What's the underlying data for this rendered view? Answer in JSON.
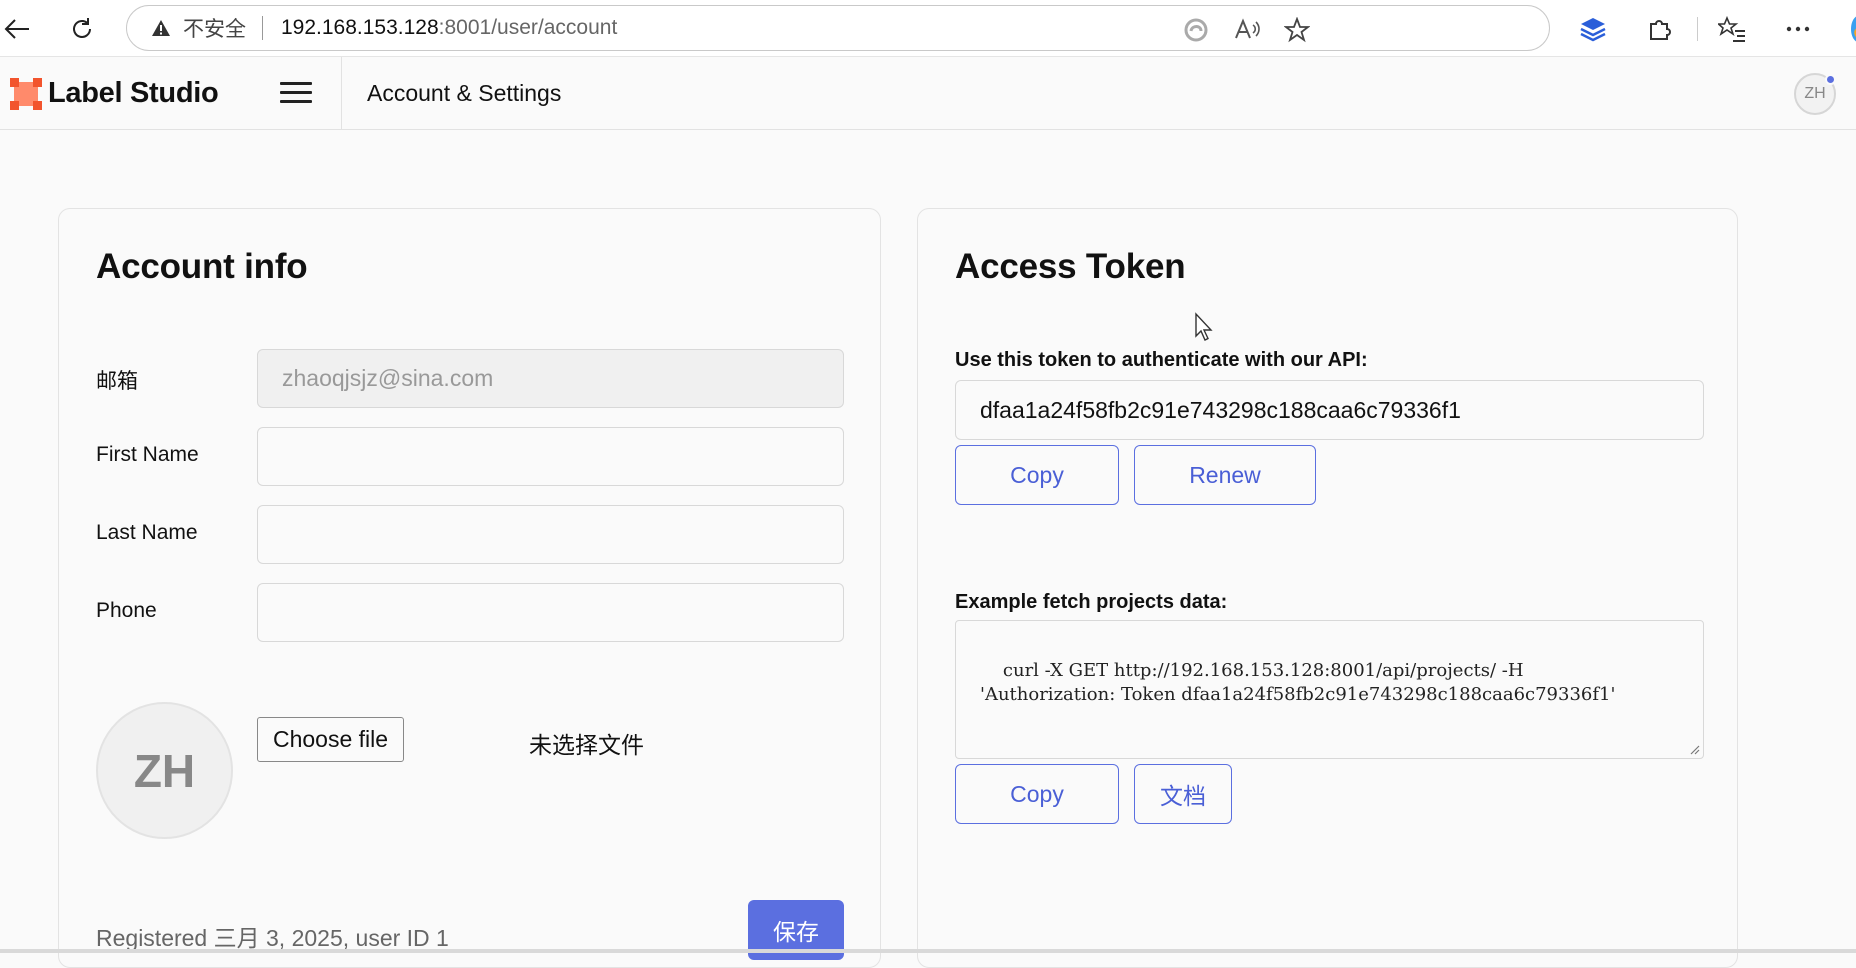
{
  "browser": {
    "insecure_label": "不安全",
    "url_host": "192.168.153.128",
    "url_path": ":8001/user/account"
  },
  "app": {
    "logo_text": "Label Studio",
    "page_title": "Account & Settings",
    "user_initials": "ZH",
    "accent_color": "#5b6fe0",
    "logo_color": "#ff6f4e"
  },
  "account": {
    "title": "Account info",
    "email_label": "邮箱",
    "email_value": "zhaoqjsjz@sina.com",
    "first_name_label": "First Name",
    "first_name_value": "",
    "last_name_label": "Last Name",
    "last_name_value": "",
    "phone_label": "Phone",
    "phone_value": "",
    "avatar_initials": "ZH",
    "choose_file_label": "Choose file",
    "no_file_text": "未选择文件",
    "registered_text": "Registered 三月 3, 2025, user ID 1",
    "save_label": "保存"
  },
  "token": {
    "title": "Access Token",
    "use_label": "Use this token to authenticate with our API:",
    "token_value": "dfaa1a24f58fb2c91e743298c188caa6c79336f1",
    "copy_label": "Copy",
    "renew_label": "Renew",
    "example_label": "Example fetch projects data:",
    "example_code": "curl -X GET http://192.168.153.128:8001/api/projects/ -H\n'Authorization: Token dfaa1a24f58fb2c91e743298c188caa6c79336f1'",
    "copy2_label": "Copy",
    "docs_label": "文档"
  }
}
